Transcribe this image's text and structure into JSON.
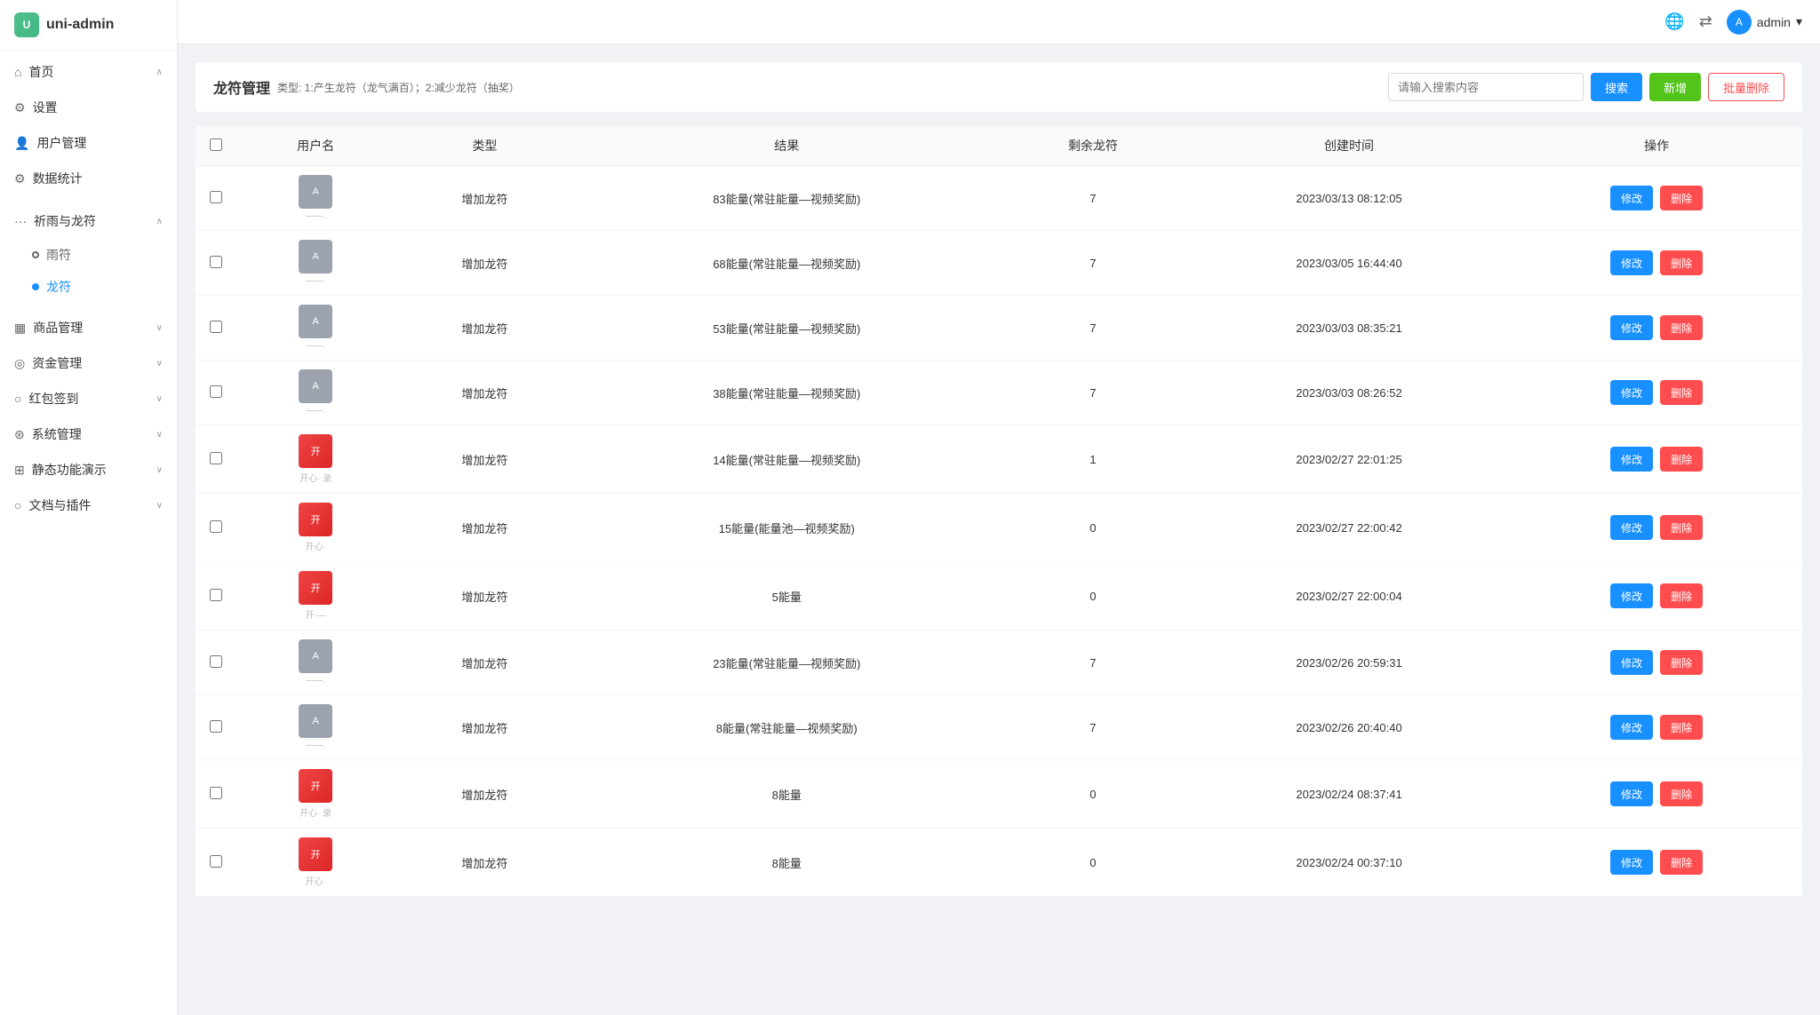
{
  "app": {
    "name": "uni-admin"
  },
  "topbar": {
    "lang_icon": "🌐",
    "translate_icon": "⇄",
    "username": "admin",
    "dropdown_icon": "▾"
  },
  "sidebar": {
    "home": "首页",
    "home_arrow": "∧",
    "settings": "设置",
    "user_mgmt": "用户管理",
    "data_stats": "数据统计",
    "rain_dragon": "祈雨与龙符",
    "rain_dragon_arrow": "∧",
    "rain_symbol": "雨符",
    "dragon_symbol": "龙符",
    "product_mgmt": "商品管理",
    "product_arrow": "∨",
    "asset_mgmt": "资金管理",
    "asset_arrow": "∨",
    "redpacket": "红包签到",
    "redpacket_arrow": "∨",
    "system_mgmt": "系统管理",
    "system_arrow": "∨",
    "static_demo": "静态功能演示",
    "static_arrow": "∨",
    "docs_plugins": "文档与插件",
    "docs_arrow": "∨"
  },
  "page": {
    "title": "龙符管理",
    "subtitle": "类型: 1:产生龙符（龙气满百）；2:减少龙符（抽奖）",
    "search_placeholder": "请输入搜索内容",
    "search_btn": "搜索",
    "new_btn": "新增",
    "batch_delete_btn": "批量删除"
  },
  "table": {
    "columns": [
      "用户名",
      "类型",
      "结果",
      "剩余龙符",
      "创建时间",
      "操作"
    ],
    "edit_label": "修改",
    "delete_label": "删除",
    "rows": [
      {
        "avatar_type": "gray",
        "avatar_label": "A",
        "username_sub": "——.",
        "type": "增加龙符",
        "result": "83能量(常驻能量—视频奖励)",
        "remaining": "7",
        "created_at": "2023/03/13 08:12:05"
      },
      {
        "avatar_type": "gray",
        "avatar_label": "A",
        "username_sub": "——.",
        "type": "增加龙符",
        "result": "68能量(常驻能量—视频奖励)",
        "remaining": "7",
        "created_at": "2023/03/05 16:44:40"
      },
      {
        "avatar_type": "gray",
        "avatar_label": "A",
        "username_sub": "——.",
        "type": "增加龙符",
        "result": "53能量(常驻能量—视频奖励)",
        "remaining": "7",
        "created_at": "2023/03/03 08:35:21"
      },
      {
        "avatar_type": "gray",
        "avatar_label": "A",
        "username_sub": "——.",
        "type": "增加龙符",
        "result": "38能量(常驻能量—视频奖励)",
        "remaining": "7",
        "created_at": "2023/03/03 08:26:52"
      },
      {
        "avatar_type": "red",
        "avatar_label": "开",
        "username_sub": "开心· 录",
        "type": "增加龙符",
        "result": "14能量(常驻能量—视频奖励)",
        "remaining": "1",
        "created_at": "2023/02/27 22:01:25"
      },
      {
        "avatar_type": "red",
        "avatar_label": "开",
        "username_sub": "开心·",
        "type": "增加龙符",
        "result": "15能量(能量池—视频奖励)",
        "remaining": "0",
        "created_at": "2023/02/27 22:00:42"
      },
      {
        "avatar_type": "red",
        "avatar_label": "开",
        "username_sub": "开·—",
        "type": "增加龙符",
        "result": "5能量",
        "remaining": "0",
        "created_at": "2023/02/27 22:00:04"
      },
      {
        "avatar_type": "gray",
        "avatar_label": "A",
        "username_sub": "——.",
        "type": "增加龙符",
        "result": "23能量(常驻能量—视频奖励)",
        "remaining": "7",
        "created_at": "2023/02/26 20:59:31"
      },
      {
        "avatar_type": "gray",
        "avatar_label": "A",
        "username_sub": "——.",
        "type": "增加龙符",
        "result": "8能量(常驻能量—视频奖励)",
        "remaining": "7",
        "created_at": "2023/02/26 20:40:40"
      },
      {
        "avatar_type": "red",
        "avatar_label": "开",
        "username_sub": "开心· 录",
        "type": "增加龙符",
        "result": "8能量",
        "remaining": "0",
        "created_at": "2023/02/24 08:37:41"
      },
      {
        "avatar_type": "red",
        "avatar_label": "开",
        "username_sub": "开心·",
        "type": "增加龙符",
        "result": "8能量",
        "remaining": "0",
        "created_at": "2023/02/24 00:37:10"
      }
    ]
  }
}
